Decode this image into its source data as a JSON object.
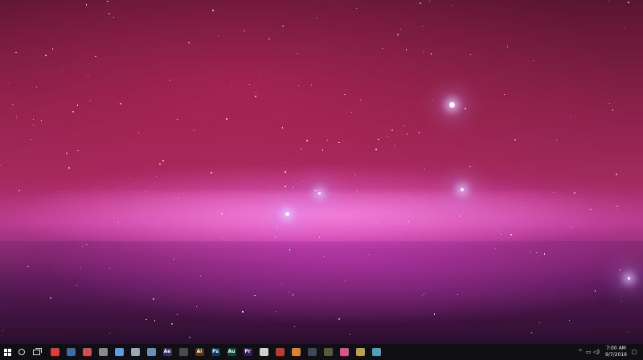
{
  "taskbar": {
    "start_icon": "windows-logo-icon",
    "search_icon": "cortana-circle-icon",
    "taskview_icon": "task-view-icon",
    "apps": [
      {
        "name": "chrome",
        "icon": "chrome-icon",
        "glyph": "",
        "color": "#e53935"
      },
      {
        "name": "steam",
        "icon": "steam-icon",
        "glyph": "",
        "color": "#3a6ea5"
      },
      {
        "name": "calendar",
        "icon": "calendar-icon",
        "glyph": "",
        "color": "#d84b4b"
      },
      {
        "name": "store",
        "icon": "store-icon",
        "glyph": "",
        "color": "#8a8a8a"
      },
      {
        "name": "media-player",
        "icon": "media-player-icon",
        "glyph": "",
        "color": "#5aa0e0"
      },
      {
        "name": "keyboard",
        "icon": "keyboard-icon",
        "glyph": "",
        "color": "#9aa7b5"
      },
      {
        "name": "photos",
        "icon": "photos-icon",
        "glyph": "",
        "color": "#6a8fbf"
      },
      {
        "name": "after-effects",
        "icon": "after-effects-icon",
        "glyph": "Ae",
        "color": "#3a2a66"
      },
      {
        "name": "terminal",
        "icon": "terminal-icon",
        "glyph": "",
        "color": "#4a4a4a"
      },
      {
        "name": "illustrator",
        "icon": "illustrator-icon",
        "glyph": "Ai",
        "color": "#5a3300"
      },
      {
        "name": "photoshop",
        "icon": "photoshop-icon",
        "glyph": "Ps",
        "color": "#0d3a5e"
      },
      {
        "name": "audition",
        "icon": "audition-icon",
        "glyph": "Au",
        "color": "#0d4a3a"
      },
      {
        "name": "premiere",
        "icon": "premiere-icon",
        "glyph": "Pr",
        "color": "#3a1a5e"
      },
      {
        "name": "corsair",
        "icon": "corsair-icon",
        "glyph": "",
        "color": "#d0d0d0"
      },
      {
        "name": "app-red",
        "icon": "shield-icon",
        "glyph": "",
        "color": "#c0392b"
      },
      {
        "name": "app-orange",
        "icon": "fire-icon",
        "glyph": "",
        "color": "#e67e22"
      },
      {
        "name": "video-editor",
        "icon": "film-icon",
        "glyph": "",
        "color": "#3a4a5a"
      },
      {
        "name": "game",
        "icon": "game-icon",
        "glyph": "",
        "color": "#5a5a3a"
      },
      {
        "name": "itunes",
        "icon": "music-icon",
        "glyph": "",
        "color": "#e74c8c"
      },
      {
        "name": "equalizer",
        "icon": "equalizer-icon",
        "glyph": "",
        "color": "#c0a040"
      },
      {
        "name": "settings",
        "icon": "gear-icon",
        "glyph": "",
        "color": "#4aa0c0"
      }
    ],
    "tray": {
      "chevron_icon": "chevron-up-icon",
      "network_icon": "network-icon",
      "volume_icon": "volume-icon",
      "time": "7:00 AM",
      "date": "9/7/2016",
      "notification_icon": "action-center-icon"
    }
  }
}
